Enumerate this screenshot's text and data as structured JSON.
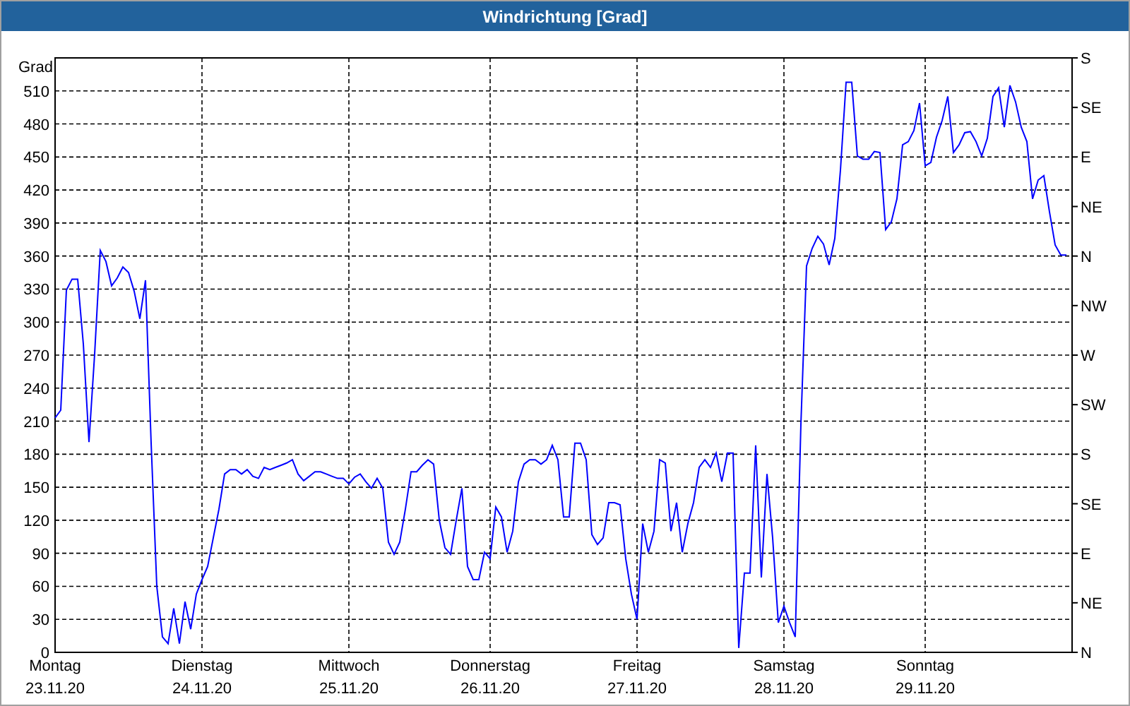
{
  "window": {
    "title": "Windrichtung [Grad]"
  },
  "chart": {
    "compass_labels": [
      "S",
      "SE",
      "E",
      "NE",
      "N",
      "NW",
      "W",
      "SW",
      "S",
      "SE",
      "E",
      "NE",
      "N"
    ],
    "chart_data": {
      "type": "line",
      "grid": true,
      "ylabel": "Grad",
      "ylim": [
        0,
        540
      ],
      "yticks": [
        0,
        30,
        60,
        90,
        120,
        150,
        180,
        210,
        240,
        270,
        300,
        330,
        360,
        390,
        420,
        450,
        480,
        510
      ],
      "categories": [
        "Montag\n23.11.20",
        null,
        null,
        null,
        null,
        null,
        null,
        null,
        null,
        null,
        null,
        null,
        null,
        null,
        null,
        null,
        null,
        null,
        null,
        null,
        null,
        null,
        null,
        null,
        null,
        null,
        "Dienstag\n24.11.20",
        null,
        null,
        null,
        null,
        null,
        null,
        null,
        null,
        null,
        null,
        null,
        null,
        null,
        null,
        null,
        null,
        null,
        null,
        null,
        null,
        null,
        null,
        null,
        null,
        null,
        "Mittwoch\n25.11.20",
        null,
        null,
        null,
        null,
        null,
        null,
        null,
        null,
        null,
        null,
        null,
        null,
        null,
        null,
        null,
        null,
        null,
        null,
        null,
        null,
        null,
        null,
        null,
        null,
        "Donnerstag\n26.11.20",
        null,
        null,
        null,
        null,
        null,
        null,
        null,
        null,
        null,
        null,
        null,
        null,
        null,
        null,
        null,
        null,
        null,
        null,
        null,
        null,
        null,
        null,
        null,
        null,
        null,
        "Freitag\n27.11.20",
        null,
        null,
        null,
        null,
        null,
        null,
        null,
        null,
        null,
        null,
        null,
        null,
        null,
        null,
        null,
        null,
        null,
        null,
        null,
        null,
        null,
        null,
        null,
        null,
        null,
        "Samstag\n28.11.20",
        null,
        null,
        null,
        null,
        null,
        null,
        null,
        null,
        null,
        null,
        null,
        null,
        null,
        null,
        null,
        null,
        null,
        null,
        null,
        null,
        null,
        null,
        null,
        null,
        "Sonntag\n29.11.20",
        null,
        null,
        null,
        null,
        null,
        null,
        null,
        null,
        null,
        null,
        null,
        null,
        null,
        null,
        null,
        null,
        null,
        null,
        null,
        null,
        null,
        null,
        null,
        null,
        null
      ],
      "series": [
        {
          "color": "#0000ff",
          "values": [
            213,
            220,
            329,
            339,
            339,
            280,
            191,
            271,
            365,
            355,
            333,
            340,
            350,
            345,
            328,
            303,
            338,
            190,
            60,
            14,
            8,
            40,
            8,
            46,
            21,
            53,
            66,
            78,
            104,
            130,
            162,
            166,
            166,
            162,
            166,
            160,
            158,
            168,
            166,
            168,
            170,
            172,
            175,
            162,
            156,
            160,
            164,
            164,
            162,
            160,
            158,
            158,
            153,
            159,
            162,
            155,
            149,
            158,
            149,
            100,
            89,
            100,
            130,
            164,
            164,
            170,
            175,
            171,
            120,
            95,
            89,
            120,
            149,
            78,
            66,
            66,
            91,
            85,
            132,
            123,
            91,
            110,
            155,
            171,
            175,
            175,
            171,
            175,
            188,
            175,
            123,
            123,
            190,
            190,
            175,
            107,
            98,
            104,
            136,
            136,
            134,
            85,
            53,
            30,
            117,
            91,
            110,
            175,
            172,
            110,
            136,
            91,
            117,
            136,
            168,
            175,
            168,
            181,
            155,
            181,
            181,
            4,
            72,
            72,
            188,
            68,
            162,
            104,
            27,
            42,
            27,
            14,
            207,
            351,
            367,
            378,
            371,
            352,
            376,
            438,
            518,
            518,
            451,
            448,
            448,
            455,
            454,
            384,
            391,
            412,
            461,
            464,
            474,
            499,
            442,
            445,
            468,
            483,
            505,
            454,
            461,
            472,
            473,
            464,
            451,
            467,
            505,
            513,
            477,
            515,
            500,
            477,
            464,
            412,
            429,
            433,
            400,
            370,
            361,
            361
          ]
        }
      ]
    }
  }
}
